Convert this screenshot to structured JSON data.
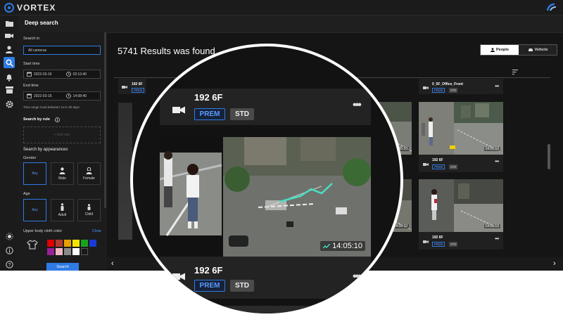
{
  "app": {
    "brand": "VORTEX"
  },
  "header": {
    "title": "Deep search"
  },
  "filters": {
    "search_in_label": "Search in",
    "camera_value": "All cameras",
    "start_label": "Start time",
    "start_date": "2022-03-16",
    "start_time": "02:13:40",
    "end_label": "End time",
    "end_date": "2022-03-16",
    "end_time": "14:08:40",
    "range_hint": "Time range must between 1s to 30 days",
    "by_rule_label": "Search by rule",
    "add_rule": "+ Add rule",
    "appearances_label": "Search by appearances",
    "gender_label": "Gender",
    "gender_options": [
      "Any",
      "Male",
      "Female"
    ],
    "age_label": "Age",
    "age_options": [
      "Any",
      "Adult",
      "Child"
    ],
    "upper_color_label": "Upper body cloth color",
    "clear": "Clear",
    "swatches": [
      "#e00000",
      "#b23a2b",
      "#e6a000",
      "#f2e600",
      "#1aa31a",
      "#1a3ad6",
      "#9b1f9b",
      "#f0b7c4",
      "#8a8a8a",
      "#ffffff",
      "#1a1a1a"
    ],
    "search_button": "Search"
  },
  "results": {
    "summary": "5741 Results was found",
    "toggle": {
      "people": "People",
      "vehicle": "Vehicle"
    }
  },
  "cards": [
    {
      "name": "192 6F",
      "prem": "PREM",
      "std": "STD"
    },
    {
      "name": "0_5F_Office_Front",
      "prem": "PREM",
      "std": "STD"
    },
    {
      "name": "192 6F",
      "prem": "PREM",
      "std": "STD",
      "time": "14:05:10"
    },
    {
      "name": "192 6F",
      "prem": "PREM",
      "std": "STD",
      "time": "14:05:10"
    },
    {
      "name": "",
      "prem": "",
      "std": "",
      "time": "14:05:10"
    },
    {
      "name": "",
      "prem": "",
      "std": "",
      "time": "14:05:10"
    }
  ],
  "magnifier": {
    "name_top": "192 6F",
    "name_bottom": "192 6F",
    "prem": "PREM",
    "std": "STD",
    "time": "14:05:10"
  },
  "colors": {
    "accent": "#2f7ae5",
    "background": "#151515"
  },
  "icons": [
    "folder-icon",
    "camera-icon",
    "person-icon",
    "deep-search-icon",
    "bell-icon",
    "archive-icon",
    "gear-icon",
    "sun-icon",
    "info-icon",
    "help-icon"
  ]
}
